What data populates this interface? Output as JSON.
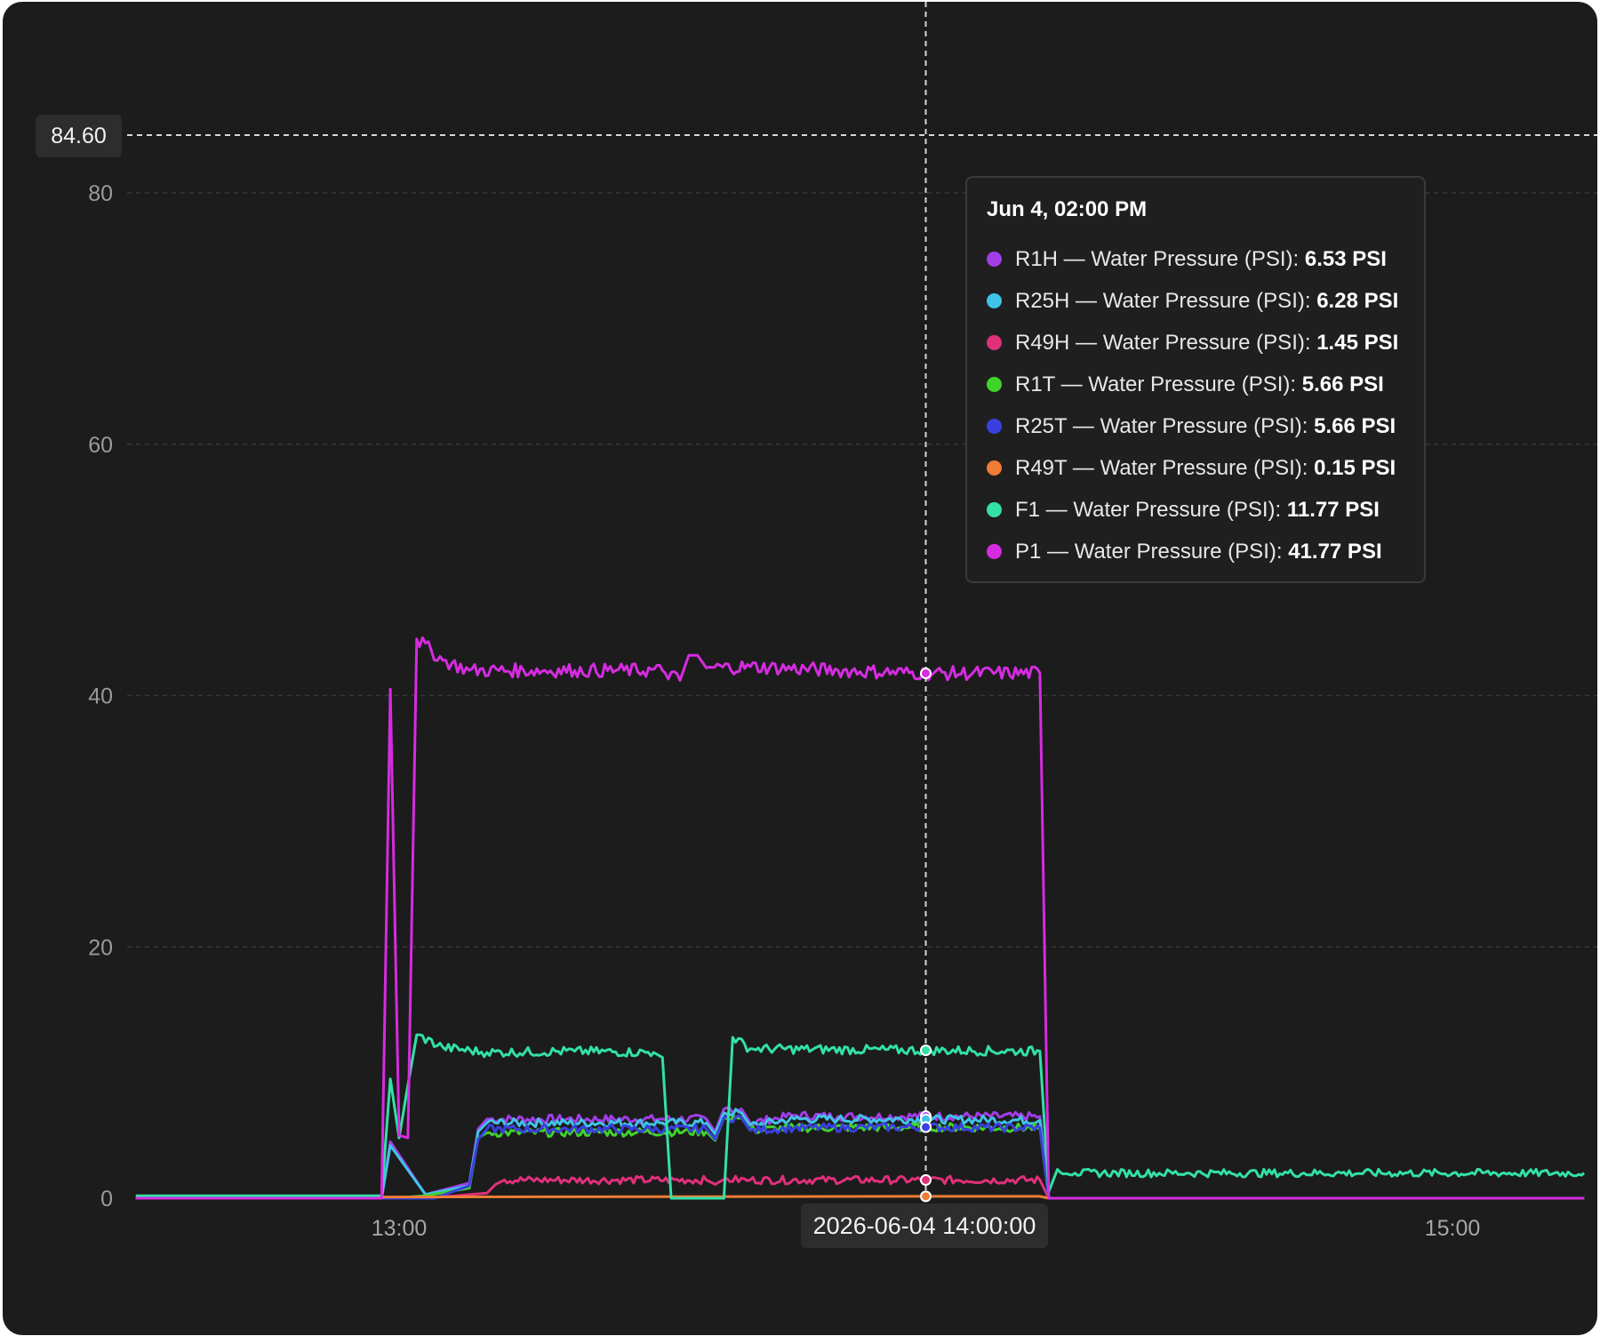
{
  "chart_data": {
    "type": "line",
    "title": "",
    "xlabel": "",
    "ylabel": "",
    "ylim": [
      0,
      84.6
    ],
    "xlim": [
      "2026-06-04 12:30:00",
      "2026-06-04 15:15:00"
    ],
    "grid": true,
    "y_ticks": [
      "0",
      "20",
      "40",
      "60",
      "80"
    ],
    "x_ticks": [
      {
        "label": "13:00",
        "time": "2026-06-04 13:00:00"
      },
      {
        "label": "15:00",
        "time": "2026-06-04 15:00:00"
      }
    ],
    "crosshair": {
      "y_value": 84.6,
      "y_label": "84.60",
      "x_time": "2026-06-04 14:00:00",
      "x_label": "2026-06-04 14:00:00"
    },
    "tooltip": {
      "title": "Jun 4, 02:00 PM",
      "rows": [
        {
          "name": "R1H — Water Pressure (PSI)",
          "value": "6.53 PSI",
          "color": "#a23de8"
        },
        {
          "name": "R25H — Water Pressure (PSI)",
          "value": "6.28 PSI",
          "color": "#3fc3e6"
        },
        {
          "name": "R49H — Water Pressure (PSI)",
          "value": "1.45 PSI",
          "color": "#e0307a"
        },
        {
          "name": "R1T — Water Pressure (PSI)",
          "value": "5.66 PSI",
          "color": "#3fd42a"
        },
        {
          "name": "R25T — Water Pressure (PSI)",
          "value": "5.66 PSI",
          "color": "#3a40e0"
        },
        {
          "name": "R49T — Water Pressure (PSI)",
          "value": "0.15 PSI",
          "color": "#ef7c35"
        },
        {
          "name": "F1 — Water Pressure (PSI)",
          "value": "11.77 PSI",
          "color": "#33e0a8"
        },
        {
          "name": "P1 — Water Pressure (PSI)",
          "value": "41.77 PSI",
          "color": "#d52ce0"
        }
      ]
    },
    "series": [
      {
        "name": "R1H — Water Pressure (PSI)",
        "color": "#a23de8",
        "points": [
          [
            "12:30",
            0
          ],
          [
            "12:58",
            0
          ],
          [
            "12:59",
            4.5
          ],
          [
            "13:03",
            0.3
          ],
          [
            "13:08",
            1.2
          ],
          [
            "13:09",
            5.5
          ],
          [
            "13:10",
            6.3
          ],
          [
            "13:30",
            6.3
          ],
          [
            "13:35",
            6.3
          ],
          [
            "13:36",
            5.3
          ],
          [
            "13:37",
            7.1
          ],
          [
            "13:39",
            7.1
          ],
          [
            "13:40",
            6.0
          ],
          [
            "13:45",
            6.6
          ],
          [
            "13:50",
            6.5
          ],
          [
            "14:00",
            6.53
          ],
          [
            "14:13",
            6.5
          ],
          [
            "14:14",
            0
          ],
          [
            "15:15",
            0
          ]
        ]
      },
      {
        "name": "R25H — Water Pressure (PSI)",
        "color": "#3fc3e6",
        "points": [
          [
            "12:30",
            0
          ],
          [
            "12:58",
            0
          ],
          [
            "12:59",
            4.2
          ],
          [
            "13:03",
            0.3
          ],
          [
            "13:08",
            1.0
          ],
          [
            "13:09",
            5.3
          ],
          [
            "13:10",
            6.0
          ],
          [
            "13:30",
            6.0
          ],
          [
            "13:35",
            6.0
          ],
          [
            "13:36",
            5.1
          ],
          [
            "13:37",
            6.8
          ],
          [
            "13:39",
            6.8
          ],
          [
            "13:40",
            5.8
          ],
          [
            "13:45",
            6.3
          ],
          [
            "13:50",
            6.3
          ],
          [
            "14:00",
            6.28
          ],
          [
            "14:13",
            6.2
          ],
          [
            "14:14",
            0
          ],
          [
            "15:15",
            0
          ]
        ]
      },
      {
        "name": "R49H — Water Pressure (PSI)",
        "color": "#e0307a",
        "points": [
          [
            "12:30",
            0
          ],
          [
            "13:03",
            0
          ],
          [
            "13:10",
            0.4
          ],
          [
            "13:11",
            1.1
          ],
          [
            "13:12",
            1.45
          ],
          [
            "13:35",
            1.45
          ],
          [
            "13:36",
            1.1
          ],
          [
            "13:37",
            1.5
          ],
          [
            "13:40",
            1.45
          ],
          [
            "14:00",
            1.45
          ],
          [
            "14:13",
            1.45
          ],
          [
            "14:14",
            0
          ],
          [
            "15:15",
            0
          ]
        ]
      },
      {
        "name": "R1T — Water Pressure (PSI)",
        "color": "#3fd42a",
        "points": [
          [
            "12:30",
            0
          ],
          [
            "12:59",
            0
          ],
          [
            "13:03",
            0.2
          ],
          [
            "13:08",
            0.8
          ],
          [
            "13:09",
            4.8
          ],
          [
            "13:10",
            5.2
          ],
          [
            "13:35",
            5.3
          ],
          [
            "13:36",
            4.6
          ],
          [
            "13:37",
            6.4
          ],
          [
            "13:39",
            6.4
          ],
          [
            "13:40",
            5.4
          ],
          [
            "13:45",
            5.6
          ],
          [
            "14:00",
            5.66
          ],
          [
            "14:13",
            5.6
          ],
          [
            "14:14",
            0
          ],
          [
            "15:15",
            0
          ]
        ]
      },
      {
        "name": "R25T — Water Pressure (PSI)",
        "color": "#3a40e0",
        "points": [
          [
            "12:30",
            0
          ],
          [
            "12:59",
            0
          ],
          [
            "13:04",
            0
          ],
          [
            "13:08",
            1.0
          ],
          [
            "13:09",
            4.7
          ],
          [
            "13:10",
            5.5
          ],
          [
            "13:35",
            5.5
          ],
          [
            "13:36",
            4.7
          ],
          [
            "13:37",
            6.4
          ],
          [
            "13:39",
            6.4
          ],
          [
            "13:40",
            5.4
          ],
          [
            "13:45",
            5.6
          ],
          [
            "14:00",
            5.66
          ],
          [
            "14:13",
            5.6
          ],
          [
            "14:14",
            0
          ],
          [
            "15:15",
            0
          ]
        ]
      },
      {
        "name": "R49T — Water Pressure (PSI)",
        "color": "#ef7c35",
        "points": [
          [
            "12:30",
            0
          ],
          [
            "13:00",
            0.1
          ],
          [
            "14:00",
            0.15
          ],
          [
            "14:13",
            0.15
          ],
          [
            "14:14",
            0
          ],
          [
            "15:15",
            0
          ]
        ]
      },
      {
        "name": "F1 — Water Pressure (PSI)",
        "color": "#33e0a8",
        "points": [
          [
            "12:30",
            0.2
          ],
          [
            "12:58",
            0.2
          ],
          [
            "12:59",
            9.5
          ],
          [
            "13:00",
            4.8
          ],
          [
            "13:01",
            9.0
          ],
          [
            "13:02",
            13.0
          ],
          [
            "13:05",
            12.0
          ],
          [
            "13:10",
            11.6
          ],
          [
            "13:20",
            11.7
          ],
          [
            "13:29",
            11.6
          ],
          [
            "13:30",
            11.2
          ],
          [
            "13:31",
            0
          ],
          [
            "13:37",
            0
          ],
          [
            "13:38",
            12.8
          ],
          [
            "13:40",
            11.9
          ],
          [
            "14:00",
            11.77
          ],
          [
            "14:13",
            11.7
          ],
          [
            "14:14",
            0.5
          ],
          [
            "14:15",
            2.3
          ],
          [
            "14:17",
            2.0
          ],
          [
            "14:30",
            2.0
          ],
          [
            "15:15",
            2.0
          ]
        ]
      },
      {
        "name": "P1 — Water Pressure (PSI)",
        "color": "#d52ce0",
        "points": [
          [
            "12:30",
            0
          ],
          [
            "12:58",
            0
          ],
          [
            "12:59",
            40.5
          ],
          [
            "13:00",
            5.0
          ],
          [
            "13:01",
            4.8
          ],
          [
            "13:02",
            44.5
          ],
          [
            "13:05",
            42.8
          ],
          [
            "13:08",
            42.0
          ],
          [
            "13:20",
            42.0
          ],
          [
            "13:30",
            42.0
          ],
          [
            "13:32",
            41.2
          ],
          [
            "13:33",
            43.2
          ],
          [
            "13:34",
            43.2
          ],
          [
            "13:35",
            42.2
          ],
          [
            "13:40",
            42.3
          ],
          [
            "13:50",
            42.0
          ],
          [
            "14:00",
            41.77
          ],
          [
            "14:13",
            41.8
          ],
          [
            "14:14",
            0
          ],
          [
            "15:15",
            0
          ]
        ]
      }
    ]
  }
}
